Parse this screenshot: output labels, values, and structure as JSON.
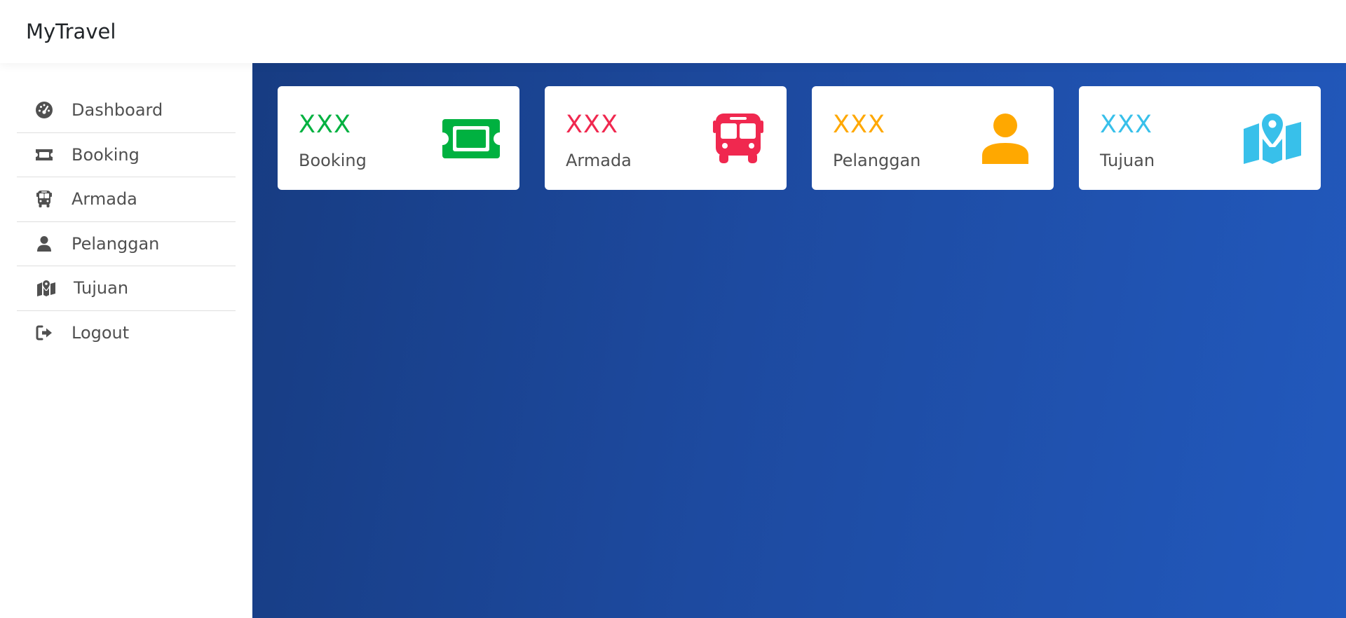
{
  "header": {
    "brand": "MyTravel"
  },
  "sidebar": {
    "items": [
      {
        "label": "Dashboard",
        "icon": "dashboard-gauge-icon"
      },
      {
        "label": "Booking",
        "icon": "ticket-icon"
      },
      {
        "label": "Armada",
        "icon": "bus-icon"
      },
      {
        "label": "Pelanggan",
        "icon": "user-icon"
      },
      {
        "label": "Tujuan",
        "icon": "map-location-icon"
      },
      {
        "label": "Logout",
        "icon": "logout-icon"
      }
    ]
  },
  "cards": [
    {
      "count": "XXX",
      "label": "Booking",
      "color": "#00b140",
      "icon": "ticket-icon"
    },
    {
      "count": "XXX",
      "label": "Armada",
      "color": "#f0284f",
      "icon": "bus-icon"
    },
    {
      "count": "XXX",
      "label": "Pelanggan",
      "color": "#ffa800",
      "icon": "user-icon"
    },
    {
      "count": "XXX",
      "label": "Tujuan",
      "color": "#38c0ea",
      "icon": "map-location-icon"
    }
  ],
  "colors": {
    "sidebar_text": "#505050",
    "main_gradient_start": "#173c82",
    "main_gradient_end": "#2259bd"
  }
}
